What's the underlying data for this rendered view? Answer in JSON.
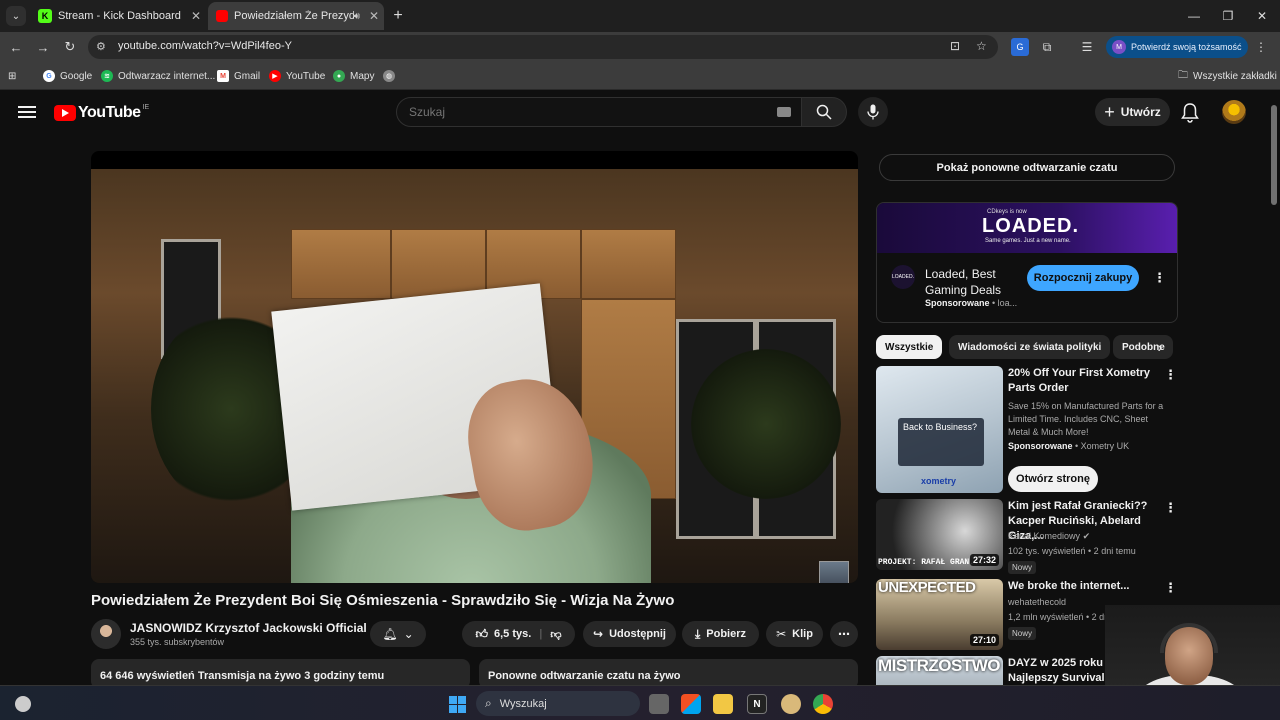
{
  "browser": {
    "tabs": [
      {
        "title": "Stream - Kick Dashboard",
        "favicon": "K"
      },
      {
        "title": "Powiedziałem Że Prezydent Boi Się Ośmieszenia - Sprawdziło Się - Wizja Na Żywo",
        "favicon": "youtube-icon"
      }
    ],
    "url": "youtube.com/watch?v=WdPil4feo-Y",
    "profile_label": "Potwierdź swoją tożsamość",
    "profile_initial": "M",
    "bookmarks": [
      "Google",
      "Odtwarzacz internet...",
      "Gmail",
      "YouTube",
      "Mapy"
    ],
    "all_bookmarks": "Wszystkie zakładki"
  },
  "youtube": {
    "logo_text": "YouTube",
    "country_code": "IE",
    "search_placeholder": "Szukaj",
    "create_label": "Utwórz"
  },
  "video": {
    "title": "Powiedziałem Że Prezydent Boi Się Ośmieszenia - Sprawdziło Się - Wizja Na Żywo",
    "channel_name": "JASNOWIDZ Krzysztof Jackowski Official",
    "subscribers": "355 tys. subskrybentów",
    "likes": "6,5 tys.",
    "share_label": "Udostępnij",
    "download_label": "Pobierz",
    "clip_label": "Klip",
    "views_line": "64 646 wyświetleń  Transmisja na żywo 3 godziny temu",
    "chat_replay_box": "Ponowne odtwarzanie czatu na żywo"
  },
  "sidebar": {
    "chat_replay_button": "Pokaż ponowne odtwarzanie czatu",
    "ad": {
      "banner_small": "CDkeys is now",
      "banner_big": "LOADED.",
      "banner_tag": "Same games. Just a new name.",
      "logo_text": "LOADED.",
      "title": "Loaded, Best Gaming Deals",
      "sponsored": "Sponsorowane",
      "domain": "loa...",
      "cta": "Rozpocznij zakupy"
    },
    "chips": [
      "Wszystkie",
      "Wiadomości ze świata polityki",
      "Podobne"
    ],
    "recommendations": [
      {
        "title": "20% Off Your First Xometry Parts Order",
        "desc": "Save 15% on Manufactured Parts for a Limited Time. Includes CNC, Sheet Metal & Much More!",
        "sponsored": "Sponsorowane",
        "advertiser": "Xometry UK",
        "cta": "Otwórz stronę",
        "thumb_heading": "Back to Business?",
        "thumb_logo": "xometry"
      },
      {
        "title": "Kim jest Rafał Graniecki?? Kacper Ruciński, Abelard Giza,...",
        "channel": "Kanał Komediowy",
        "meta": "102 tys. wyświetleń • 2 dni temu",
        "badge": "Nowy",
        "duration": "27:32",
        "thumb_caption": "PROJEKT: RAFAŁ GRAN..."
      },
      {
        "title": "We broke the internet...",
        "channel": "wehatethecold",
        "meta": "1,2 mln wyświetleń • 2 dni...",
        "badge": "Nowy",
        "duration": "27:10",
        "thumb_caption": "UNEXPECTED"
      },
      {
        "title": "DAYZ w 2025 roku to Najlepszy Survival?",
        "thumb_caption": "MISTRZOSTWO"
      }
    ]
  },
  "taskbar": {
    "search_label": "Wyszukaj"
  }
}
